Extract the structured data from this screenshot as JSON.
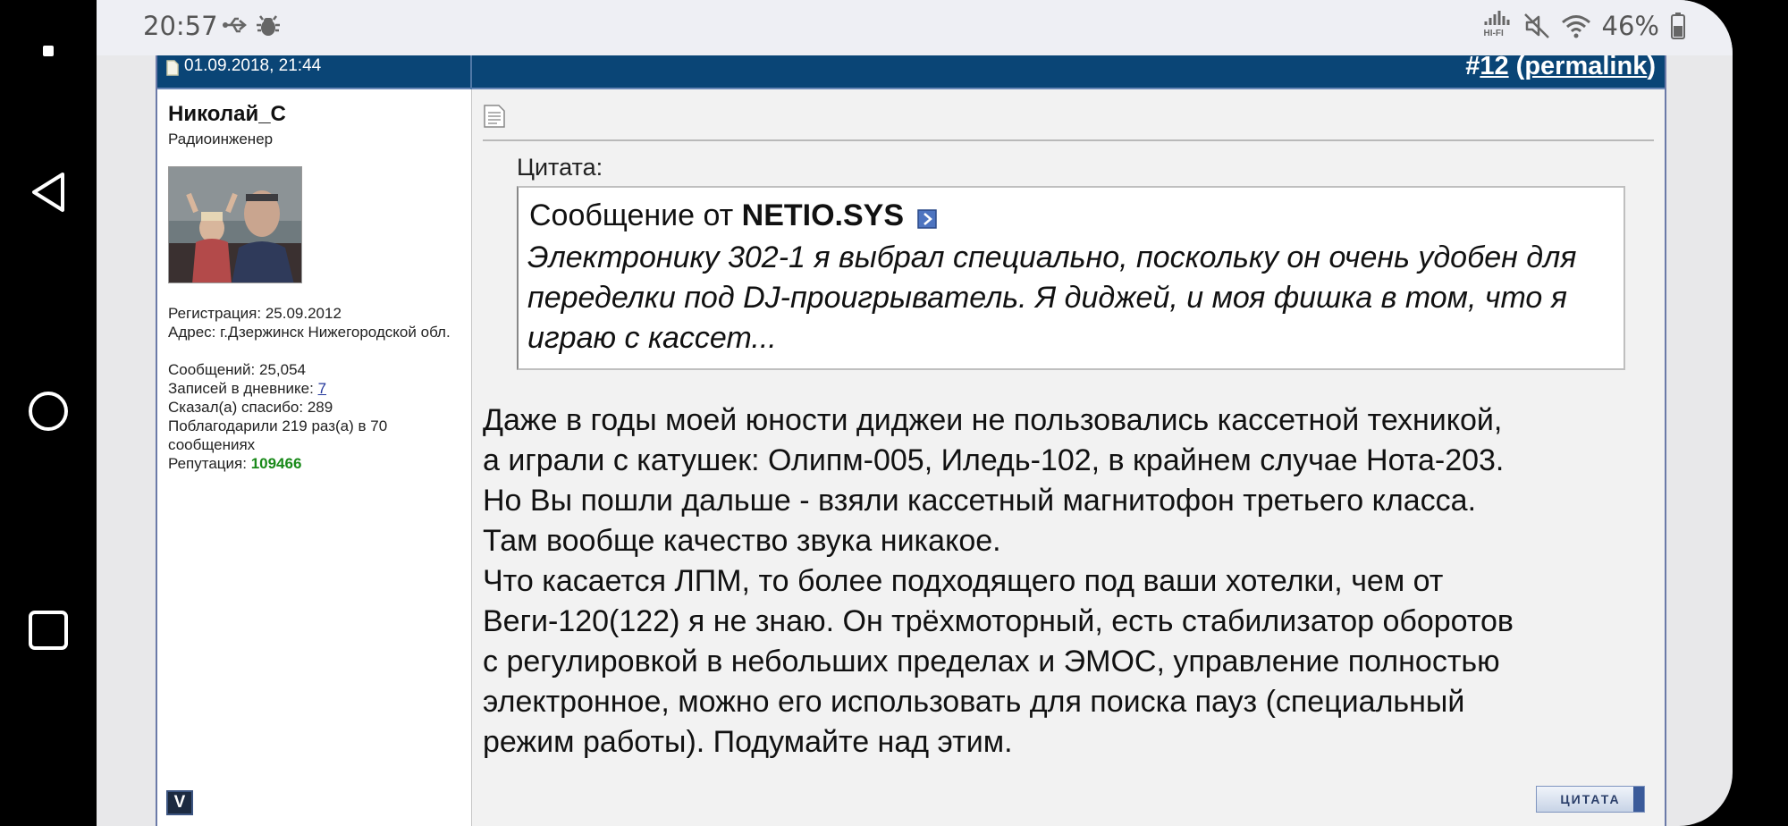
{
  "status_bar": {
    "time": "20:57",
    "battery_percent": "46%",
    "hifi_label": "HI-FI"
  },
  "post": {
    "date": "01.09.2018, 21:44",
    "number_prefix": "#",
    "number": "12",
    "permalink_open": "(",
    "permalink_label": "permalink",
    "permalink_close": ")",
    "quote_button": "ЦИТАТА"
  },
  "user": {
    "name": "Николай_С",
    "title": "Радиоинженер",
    "registration": "Регистрация: 25.09.2012",
    "address": "Адрес: г.Дзержинск Нижегородской обл.",
    "messages": "Сообщений: 25,054",
    "diary_label": "Записей в дневнике: ",
    "diary_count": "7",
    "said_thanks": "Сказал(а) спасибо: 289",
    "was_thanked": "Поблагодарили 219 раз(а) в 70 сообщениях",
    "reputation_label": "Репутация: ",
    "reputation_value": "109466",
    "badge": "V"
  },
  "quote": {
    "label": "Цитата:",
    "from_prefix": "Сообщение от ",
    "author": "NETIO.SYS",
    "text": "Электронику 302-1 я выбрал специально, поскольку он очень удобен для переделки под DJ-проигрыватель. Я диджей, и моя фишка в том, что я играю с кассет..."
  },
  "message": {
    "line1": "Даже в годы моей юности диджеи не пользовались кассетной техникой,",
    "line2": "а играли с катушек: Олипм-005, Иледь-102, в крайнем случае Нота-203.",
    "line3": "Но Вы пошли дальше - взяли кассетный магнитофон третьего класса.",
    "line4": "Там вообще качество звука никакое.",
    "line5": "Что касается ЛПМ, то более подходящего под ваши хотелки, чем от",
    "line6": "Веги-120(122) я не знаю. Он трёхмоторный, есть стабилизатор оборотов",
    "line7": "с регулировкой в небольших пределах и ЭМОС, управление полностью",
    "line8": "электронное, можно его использовать для поиска пауз (специальный",
    "line9": "режим работы). Подумайте над этим."
  }
}
